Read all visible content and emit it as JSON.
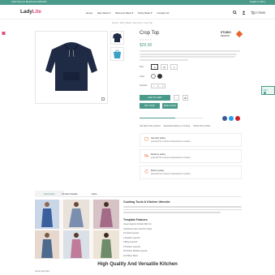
{
  "topbar": {
    "promo": "Hello! Summer Big Discount 60%OFF",
    "right": "English ▾    USD ▾"
  },
  "header": {
    "logo_main": "Lady",
    "logo_accent": "Lite",
    "nav": [
      "Home",
      "Men Wear ▾",
      "Womens Wear ▾",
      "Party Wear ▾",
      "Contact Us"
    ],
    "cart_label": "0 ITEMS"
  },
  "breadcrumb": "Home  /  Party Wear  /  Men Set  /  Crop Top",
  "product": {
    "title": "Crop Top",
    "stars": "★★★★★",
    "price": "$29.00",
    "brand_line1": "STUDIO",
    "brand_line2": "DESIGN",
    "size_label": "Size",
    "sizes": [
      "S",
      "M",
      "L"
    ],
    "color_label": "Color",
    "quantity_label": "Quantity",
    "quantity_value": "1",
    "qty_minus": "−",
    "qty_plus": "+",
    "add_to_cart": "ADD TO CART",
    "buy_now": "BUY NOW",
    "size_chart": "SIZE CHART",
    "wishlist_icon": "♡",
    "compare_icon": "⇄",
    "actions": [
      "Ask about this product",
      "Estimated delivery: 2-5 days",
      "Share this product"
    ]
  },
  "policies": [
    {
      "title": "Security policy",
      "desc": "(edit with the Customer Reassurance module)"
    },
    {
      "title": "Delivery policy",
      "desc": "(edit with the Customer Reassurance module)"
    },
    {
      "title": "Return policy",
      "desc": "(edit with the Customer Reassurance module)"
    }
  ],
  "tabs": [
    "Description",
    "Product Details",
    "Video"
  ],
  "content": {
    "section_title": "Cooking Tools & Kitchen Utensils",
    "sub_title": "Template Features",
    "features": [
      "Great Opacity Perfect With Fit",
      "Unlimited Color and Font Style",
      "15 Solid Layouts",
      "2 Header Layouts",
      "4 Blog Layouts",
      "3 Product Layouts",
      "8 Product Details Layouts",
      "and Many More"
    ],
    "big_title": "High Quality And Versatile Kitchen",
    "bottom_text": "Just at your door..."
  },
  "side_widget_label": "Offer",
  "colors": {
    "accent": "#4a9a8a",
    "pink": "#e0527b",
    "brand_orange": "#e8642e",
    "product_navy": "#1f2a44"
  }
}
